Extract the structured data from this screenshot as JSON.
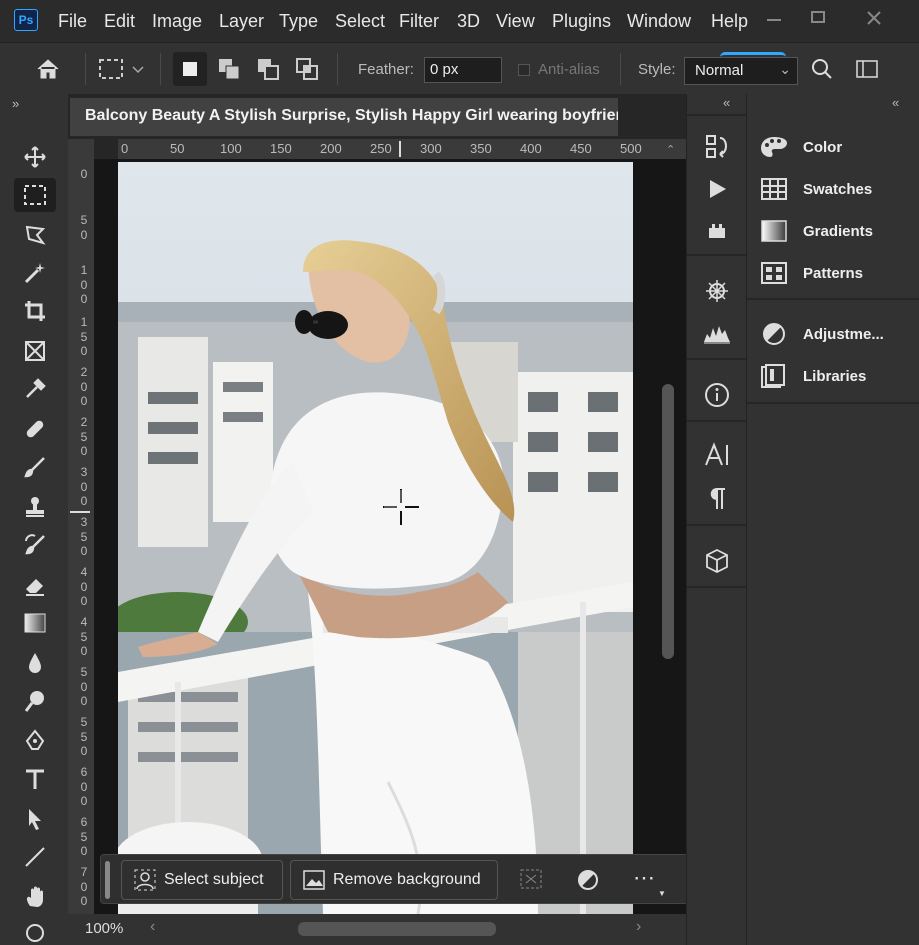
{
  "app": {
    "logo": "Ps"
  },
  "menubar": {
    "items": [
      "File",
      "Edit",
      "Image",
      "Layer",
      "Type",
      "Select",
      "Filter",
      "3D",
      "View",
      "Plugins",
      "Window",
      "Help"
    ]
  },
  "options": {
    "feather_label": "Feather:",
    "feather_value": "0 px",
    "antialias_label": "Anti-alias",
    "style_label": "Style:",
    "style_value": "Normal"
  },
  "document": {
    "tab_title": "Balcony Beauty A Stylish Surprise, Stylish Happy Girl wearing boyfriend",
    "zoom": "100%",
    "hruler_ticks": [
      "0",
      "50",
      "100",
      "150",
      "200",
      "250",
      "300",
      "350",
      "400",
      "450",
      "500"
    ],
    "vruler_ticks": [
      [
        "0"
      ],
      [
        "5",
        "0"
      ],
      [
        "1",
        "0",
        "0"
      ],
      [
        "1",
        "5",
        "0"
      ],
      [
        "2",
        "0",
        "0"
      ],
      [
        "2",
        "5",
        "0"
      ],
      [
        "3",
        "0",
        "0"
      ],
      [
        "3",
        "5",
        "0"
      ],
      [
        "4",
        "0",
        "0"
      ],
      [
        "4",
        "5",
        "0"
      ],
      [
        "5",
        "0",
        "0"
      ],
      [
        "5",
        "5",
        "0"
      ],
      [
        "6",
        "0",
        "0"
      ],
      [
        "6",
        "5",
        "0"
      ],
      [
        "7",
        "0",
        "0"
      ]
    ]
  },
  "taskbar": {
    "select_subject": "Select subject",
    "remove_background": "Remove background"
  },
  "panels": {
    "items": [
      {
        "label": "Color",
        "icon": "palette-icon"
      },
      {
        "label": "Swatches",
        "icon": "grid-icon"
      },
      {
        "label": "Gradients",
        "icon": "gradient-icon"
      },
      {
        "label": "Patterns",
        "icon": "patterns-icon"
      },
      {
        "label": "Adjustme...",
        "icon": "adjustments-icon"
      },
      {
        "label": "Libraries",
        "icon": "libraries-icon"
      }
    ]
  },
  "colors": {
    "accent": "#31a8ff",
    "menubar": "#2b2b2b",
    "panel": "#323232",
    "workspace": "#262626"
  }
}
